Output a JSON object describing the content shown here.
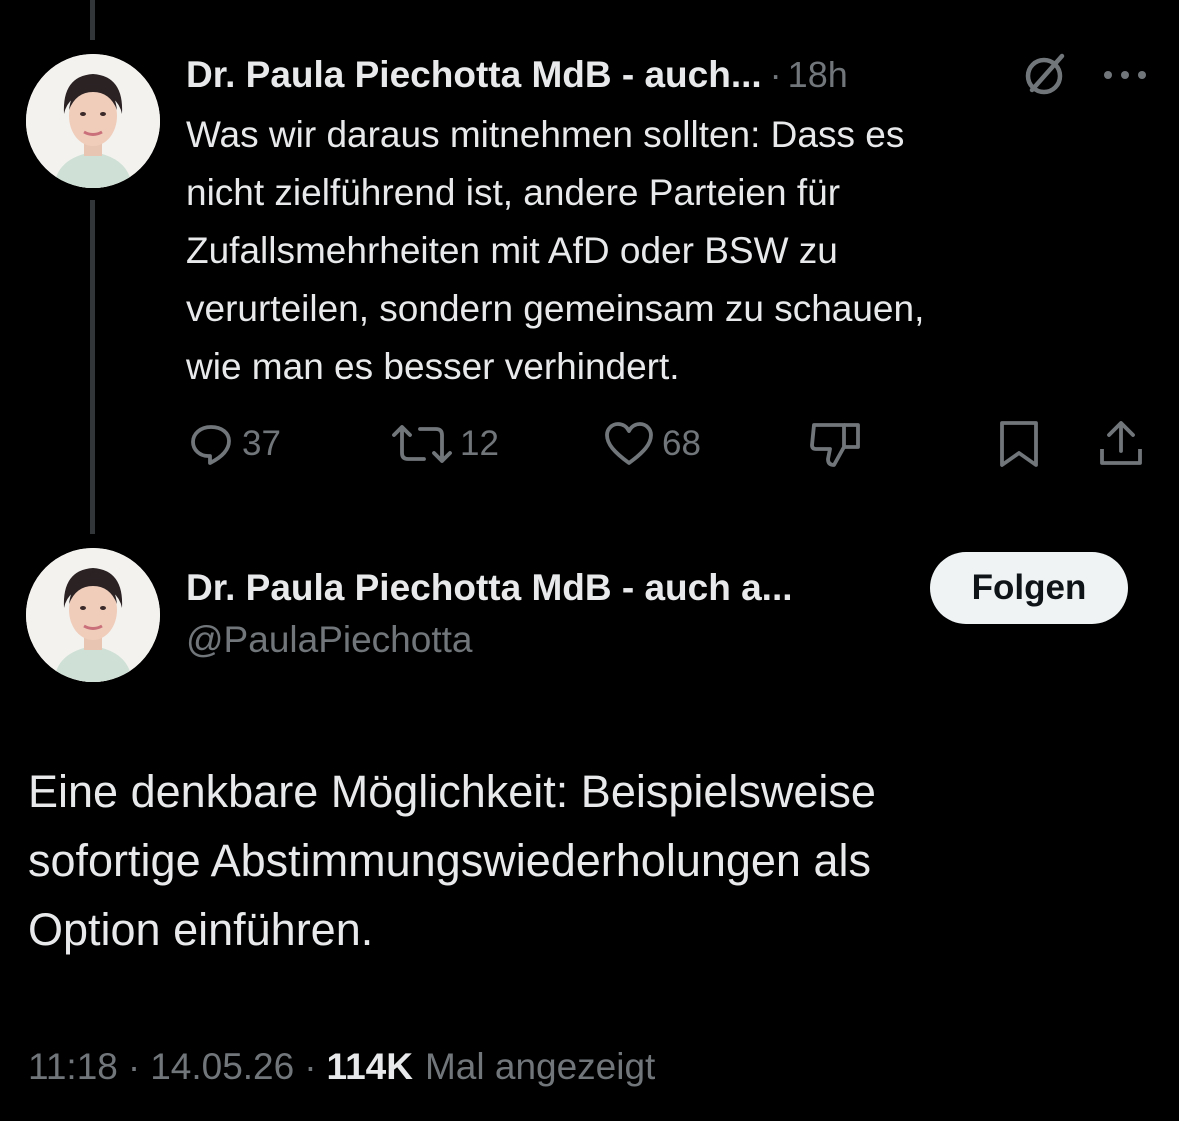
{
  "parent_tweet": {
    "display_name": "Dr. Paula Piechotta MdB - auch...",
    "separator": "·",
    "time": "18h",
    "text_lines": [
      "Was wir daraus mitnehmen sollten: Dass es",
      "nicht zielführend ist, andere Parteien für",
      "Zufallsmehrheiten mit AfD oder BSW zu",
      "verurteilen, sondern gemeinsam zu schauen,",
      "wie man es besser verhindert."
    ],
    "actions": {
      "replies": "37",
      "retweets": "12",
      "likes": "68"
    },
    "icons": [
      "grok-icon",
      "more-icon",
      "reply-icon",
      "retweet-icon",
      "like-icon",
      "dislike-icon",
      "bookmark-icon",
      "share-icon"
    ]
  },
  "main_tweet": {
    "display_name": "Dr. Paula Piechotta MdB - auch a...",
    "handle": "@PaulaPiechotta",
    "follow_label": "Folgen",
    "text_lines": [
      "Eine denkbare Möglichkeit: Beispielsweise",
      "sofortige Abstimmungswiederholungen als",
      "Option einführen."
    ],
    "time": "11:18",
    "separator": "·",
    "date": "14.05.26",
    "views_count": "114K",
    "views_label": "Mal angezeigt"
  },
  "colors": {
    "background": "#000000",
    "text_primary": "#e7e9ea",
    "text_secondary": "#71767b",
    "thread_line": "#333639",
    "button_bg": "#eff3f4",
    "button_text": "#0f1419"
  }
}
